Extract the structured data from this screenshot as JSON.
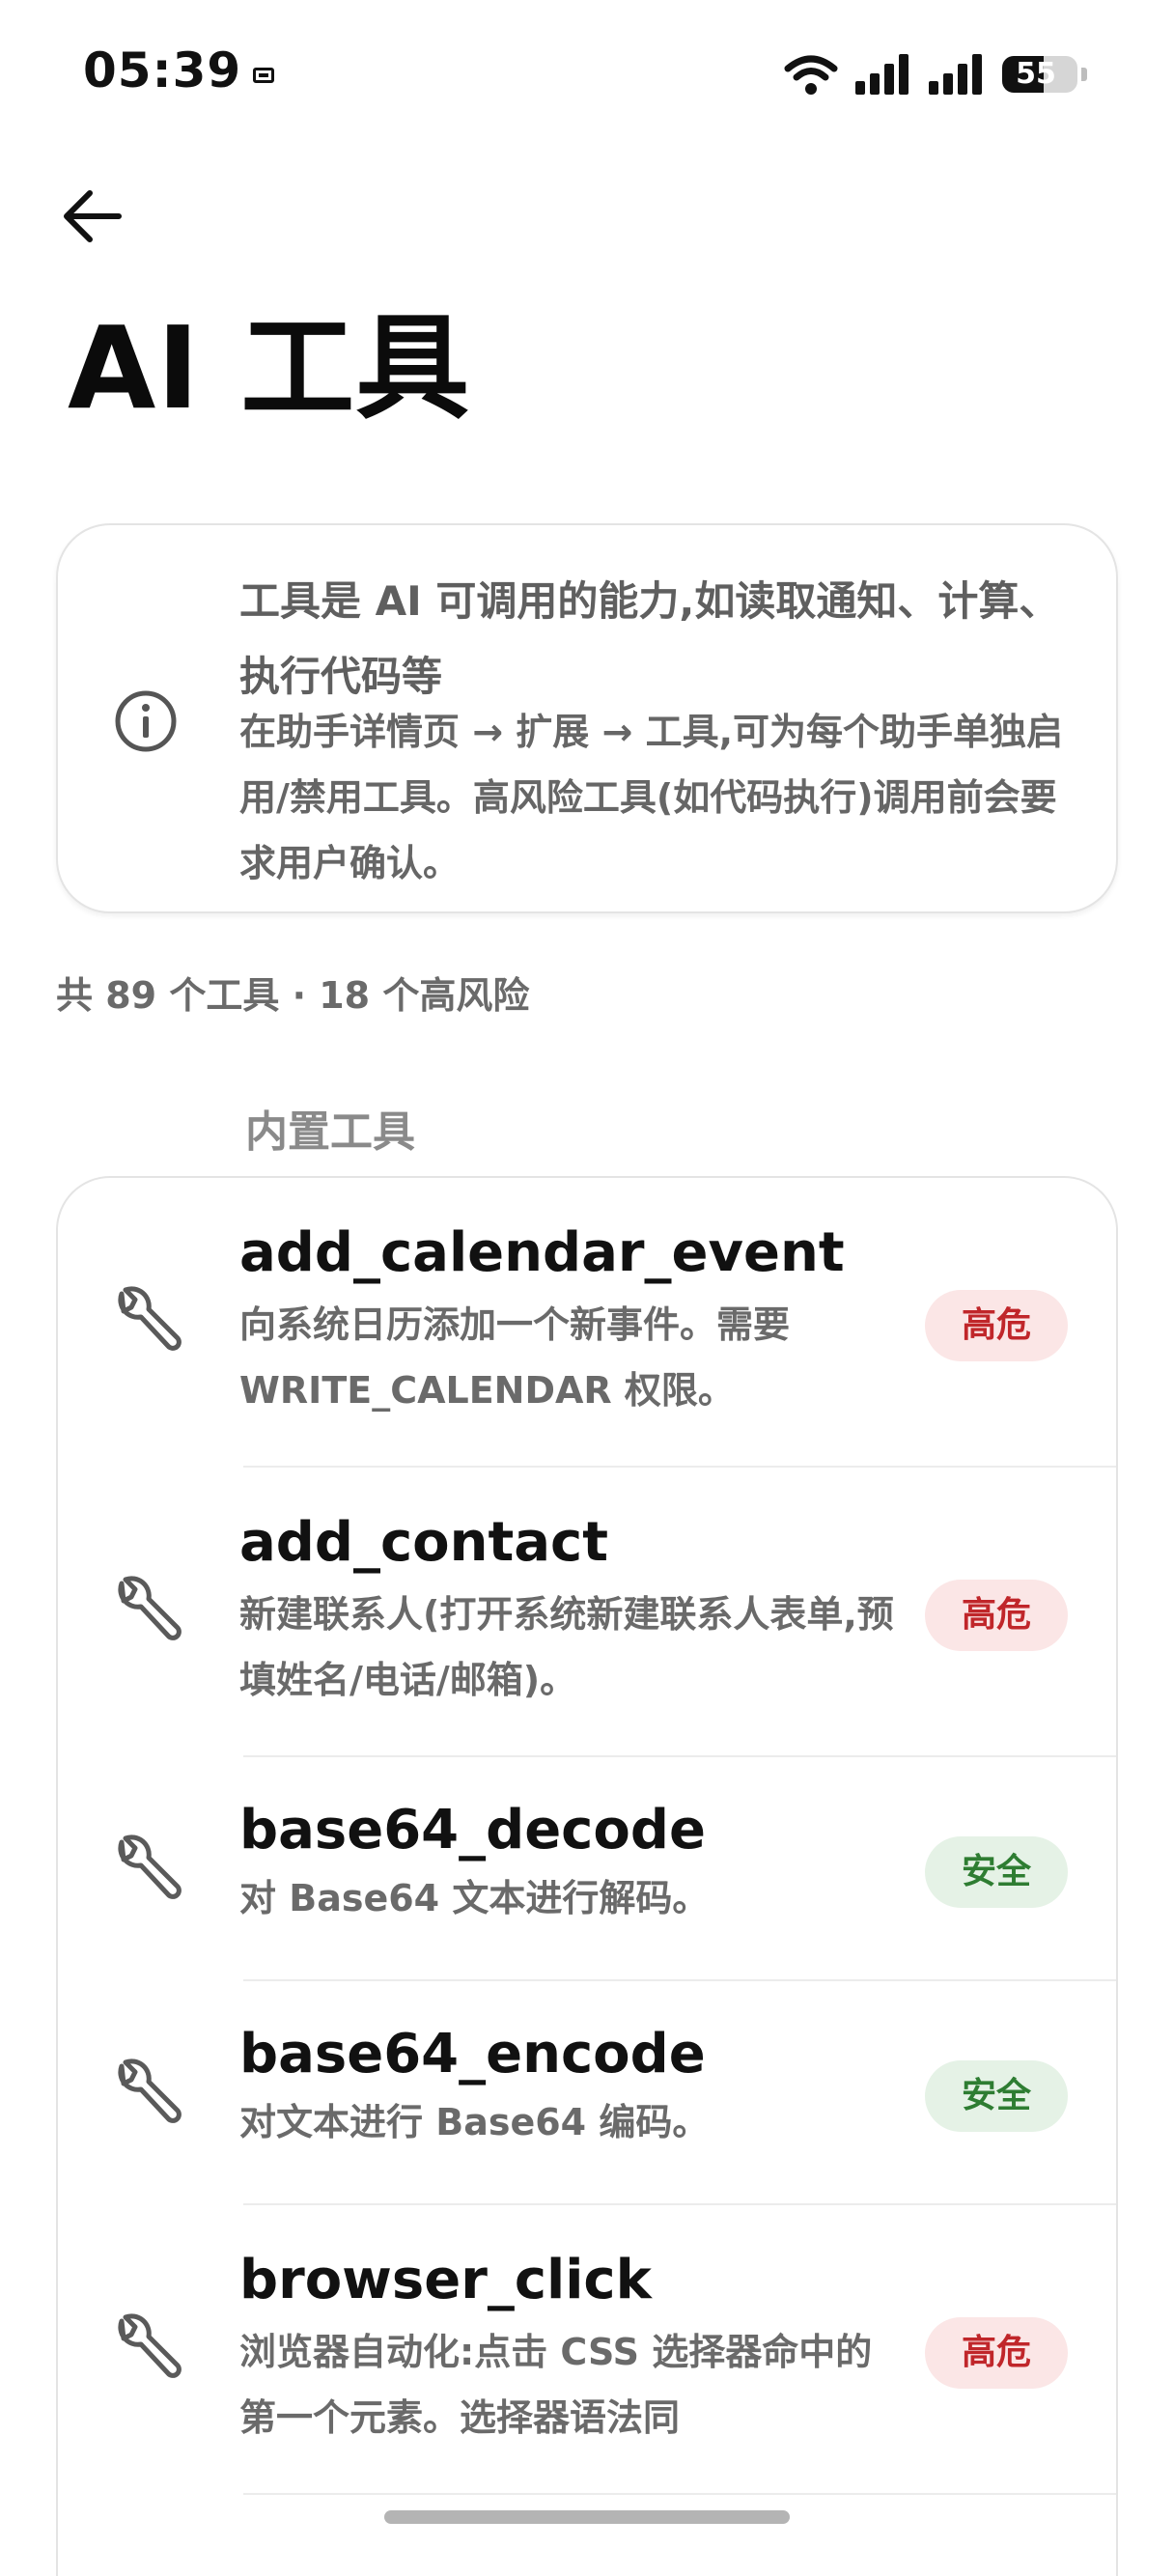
{
  "status_bar": {
    "time": "05:39",
    "battery_level": "55",
    "battery_fraction": 0.55,
    "icons": [
      "sim-icon",
      "wifi-icon",
      "signal-icon",
      "signal-icon",
      "battery-icon"
    ]
  },
  "nav": {
    "back_icon": "arrow-left-icon"
  },
  "page": {
    "title": "AI 工具"
  },
  "info": {
    "icon": "info-icon",
    "main": "工具是 AI 可调用的能力,如读取通知、计算、执行代码等",
    "sub": "在助手详情页 → 扩展 → 工具,可为每个助手单独启用/禁用工具。高风险工具(如代码执行)调用前会要求用户确认。"
  },
  "summary": "共 89 个工具 · 18 个高风险",
  "section": {
    "label": "内置工具"
  },
  "tools": [
    {
      "name": "add_calendar_event",
      "desc": "向系统日历添加一个新事件。需要 WRITE_CALENDAR 权限。",
      "badge": "高危",
      "risk": "high"
    },
    {
      "name": "add_contact",
      "desc": "新建联系人(打开系统新建联系人表单,预填姓名/电话/邮箱)。",
      "badge": "高危",
      "risk": "high"
    },
    {
      "name": "base64_decode",
      "desc": "对 Base64 文本进行解码。",
      "badge": "安全",
      "risk": "safe"
    },
    {
      "name": "base64_encode",
      "desc": "对文本进行 Base64 编码。",
      "badge": "安全",
      "risk": "safe"
    },
    {
      "name": "browser_click",
      "desc": "浏览器自动化:点击 CSS 选择器命中的第一个元素。选择器语法同",
      "badge": "高危",
      "risk": "high"
    }
  ],
  "colors": {
    "high_bg": "#fbe6e6",
    "high_text": "#c0262a",
    "safe_bg": "#e5f2e6",
    "safe_text": "#2e7d32"
  }
}
